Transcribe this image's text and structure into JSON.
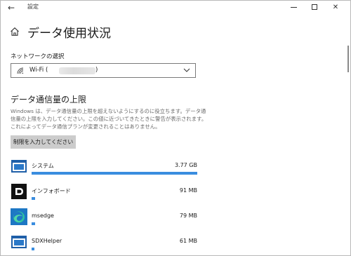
{
  "window": {
    "title": "設定",
    "back_icon": "back-arrow-icon",
    "minimize_icon": "minimize-icon",
    "maximize_icon": "maximize-icon",
    "close_icon": "close-icon"
  },
  "page": {
    "home_icon": "home-icon",
    "title": "データ使用状況"
  },
  "network": {
    "label": "ネットワークの選択",
    "selected": "Wi-Fi (",
    "selected_close": ")",
    "wifi_icon": "wifi-icon",
    "chevron_icon": "chevron-down-icon"
  },
  "limit": {
    "heading": "データ通信量の上限",
    "description_lines": [
      "Windows は、データ通信量の上限を超えないようにするのに役立ちます。データ通",
      "信量の上限を入力してください。この値に近づいてきたときに警告が表示されます。",
      "これによってデータ通信プランが変更されることはありません。"
    ],
    "button_label": "制限を入力してください"
  },
  "usage": {
    "accent_color": "#3a8ddf",
    "items": [
      {
        "name": "システム",
        "size": "3.77 GB",
        "fraction": 1.0,
        "icon": "system-window-icon"
      },
      {
        "name": "インフォボード",
        "size": "91 MB",
        "fraction": 0.02,
        "icon": "infoboard-app-icon"
      },
      {
        "name": "msedge",
        "size": "79 MB",
        "fraction": 0.02,
        "icon": "edge-browser-icon"
      },
      {
        "name": "SDXHelper",
        "size": "61 MB",
        "fraction": 0.016,
        "icon": "sdxhelper-window-icon"
      }
    ]
  }
}
